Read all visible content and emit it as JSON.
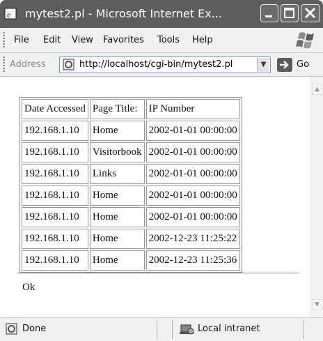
{
  "window": {
    "title": "mytest2.pl - Microsoft Internet Ex..."
  },
  "menu": {
    "items": [
      "File",
      "Edit",
      "View",
      "Favorites",
      "Tools",
      "Help"
    ]
  },
  "address": {
    "label": "Address",
    "url": "http://localhost/cgi-bin/mytest2.pl",
    "go_label": "Go"
  },
  "table": {
    "headers": [
      "Date Accessed",
      "Page Title:",
      "IP Number"
    ],
    "rows": [
      [
        "192.168.1.10",
        "Home",
        "2002-01-01 00:00:00"
      ],
      [
        "192.168.1.10",
        "Visitorbook",
        "2002-01-01 00:00:00"
      ],
      [
        "192.168.1.10",
        "Links",
        "2002-01-01 00:00:00"
      ],
      [
        "192.168.1.10",
        "Home",
        "2002-01-01 00:00:00"
      ],
      [
        "192.168.1.10",
        "Home",
        "2002-01-01 00:00:00"
      ],
      [
        "192.168.1.10",
        "Home",
        "2002-12-23 11:25:22"
      ],
      [
        "192.168.1.10",
        "Home",
        "2002-12-23 11:25:36"
      ]
    ]
  },
  "content": {
    "status_message": "Ok"
  },
  "statusbar": {
    "left_text": "Done",
    "zone_text": "Local intranet"
  }
}
